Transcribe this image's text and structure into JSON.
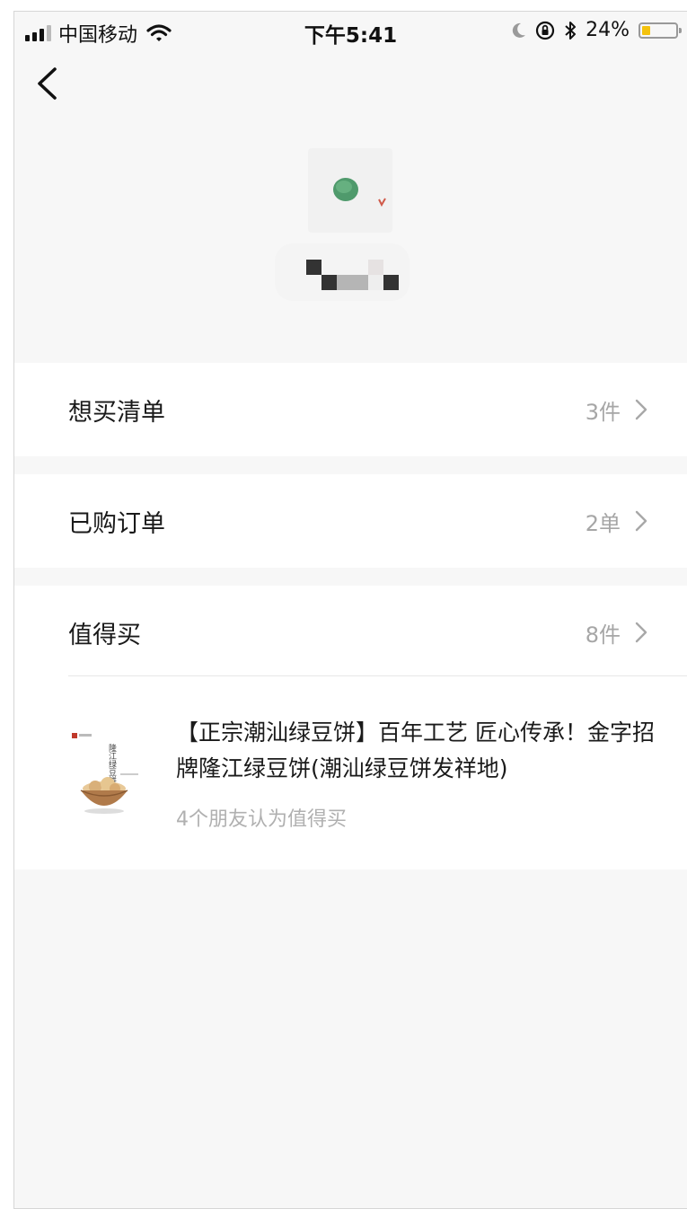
{
  "status_bar": {
    "carrier": "中国移动",
    "time": "下午5:41",
    "battery": "24%",
    "icons": [
      "signal-icon",
      "wifi-icon",
      "moon-icon",
      "rotation-lock-icon",
      "bluetooth-icon",
      "battery-icon"
    ]
  },
  "nav": {
    "back_icon": "chevron-left-icon"
  },
  "menu": {
    "wishlist": {
      "label": "想买清单",
      "count": "3件"
    },
    "orders": {
      "label": "已购订单",
      "count": "2单"
    },
    "worth": {
      "label": "值得买",
      "count": "8件"
    }
  },
  "product": {
    "title": "【正宗潮汕绿豆饼】百年工艺 匠心传承！金字招牌隆江绿豆饼(潮汕绿豆饼发祥地)",
    "subtitle": "4个朋友认为值得买",
    "thumb_text": "隆江绿豆饼"
  },
  "colors": {
    "accent_battery": "#f4c20d",
    "secondary_text": "#a6a6a6",
    "background": "#f7f7f7"
  }
}
